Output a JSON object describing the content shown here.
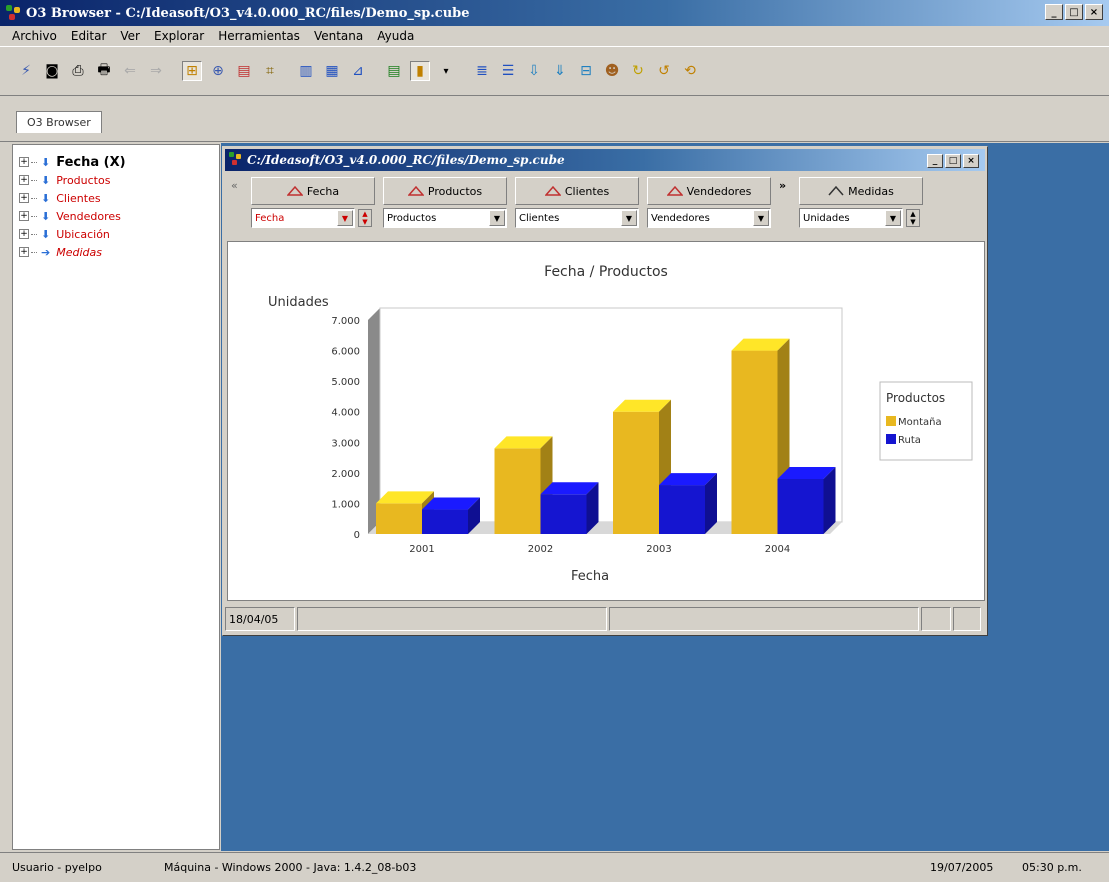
{
  "app": {
    "title": "O3 Browser - C:/Ideasoft/O3_v4.0.000_RC/files/Demo_sp.cube",
    "win_buttons": [
      "_",
      "□",
      "×"
    ]
  },
  "menu": [
    "Archivo",
    "Editar",
    "Ver",
    "Explorar",
    "Herramientas",
    "Ventana",
    "Ayuda"
  ],
  "tab": {
    "label": "O3 Browser"
  },
  "tree": {
    "items": [
      {
        "label": "Fecha (X)",
        "style": "bold"
      },
      {
        "label": "Productos",
        "style": "normal"
      },
      {
        "label": "Clientes",
        "style": "normal"
      },
      {
        "label": "Vendedores",
        "style": "normal"
      },
      {
        "label": "Ubicación",
        "style": "normal"
      },
      {
        "label": "Medidas",
        "style": "italic"
      }
    ]
  },
  "child": {
    "title": "C:/Ideasoft/O3_v4.0.000_RC/files/Demo_sp.cube",
    "dims": [
      {
        "label": "Fecha",
        "value": "Fecha"
      },
      {
        "label": "Productos",
        "value": "Productos"
      },
      {
        "label": "Clientes",
        "value": "Clientes"
      },
      {
        "label": "Vendedores",
        "value": "Vendedores"
      },
      {
        "label": "Medidas",
        "value": "Unidades"
      }
    ],
    "more": "»",
    "collapse": "«",
    "status_date": "18/04/05"
  },
  "chart_data": {
    "type": "bar",
    "title": "Fecha / Productos",
    "xlabel": "Fecha",
    "ylabel": "Unidades",
    "categories": [
      "2001",
      "2002",
      "2003",
      "2004"
    ],
    "yticks": [
      "0",
      "1.000",
      "2.000",
      "3.000",
      "4.000",
      "5.000",
      "6.000",
      "7.000"
    ],
    "ylim": [
      0,
      7000
    ],
    "legend_title": "Productos",
    "legend_position": "right",
    "series": [
      {
        "name": "Montaña",
        "values": [
          1000,
          2800,
          4000,
          6000
        ],
        "color": "#e8b820"
      },
      {
        "name": "Ruta",
        "values": [
          800,
          1300,
          1600,
          1800
        ],
        "color": "#1515d0"
      }
    ]
  },
  "status": {
    "user": "Usuario - pyelpo",
    "machine": "Máquina - Windows 2000 - Java: 1.4.2_08-b03",
    "date": "19/07/2005",
    "time": "05:30 p.m."
  }
}
